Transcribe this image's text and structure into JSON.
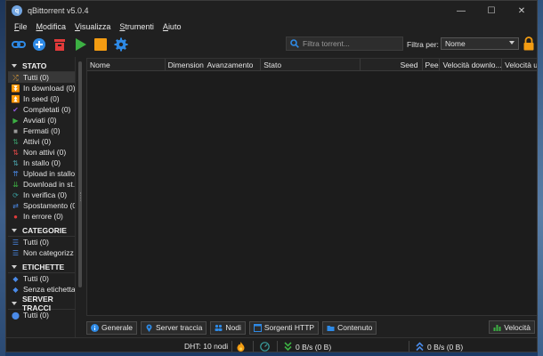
{
  "window": {
    "title": "qBittorrent v5.0.4",
    "icon_letter": "q"
  },
  "window_controls": [
    "—",
    "☐",
    "✕"
  ],
  "menu": [
    {
      "u": "F",
      "rest": "ile"
    },
    {
      "u": "M",
      "rest": "odifica"
    },
    {
      "u": "V",
      "rest": "isualizza"
    },
    {
      "u": "S",
      "rest": "trumenti"
    },
    {
      "u": "A",
      "rest": "iuto"
    }
  ],
  "toolbar": {
    "icons": [
      "add-link-icon",
      "add-torrent-icon",
      "delete-icon",
      "resume-icon",
      "pause-icon",
      "options-icon"
    ],
    "search_placeholder": "Filtra torrent...",
    "filter_label": "Filtra per:",
    "filter_value": "Nome"
  },
  "sidebar": {
    "status": {
      "header": "STATO",
      "items": [
        {
          "label": "Tutti (0)",
          "icon": "shuffle-icon",
          "color": "#e8a33a"
        },
        {
          "label": "In download (0)",
          "icon": "download-icon",
          "color": "#3cb043"
        },
        {
          "label": "In seed (0)",
          "icon": "upload-icon",
          "color": "#4a8ae8"
        },
        {
          "label": "Completati (0)",
          "icon": "check-icon",
          "color": "#8e59d8"
        },
        {
          "label": "Avviati (0)",
          "icon": "play-icon",
          "color": "#3cb043"
        },
        {
          "label": "Fermati (0)",
          "icon": "stop-icon",
          "color": "#9a9a9a"
        },
        {
          "label": "Attivi (0)",
          "icon": "active-icon",
          "color": "#3a9a6a"
        },
        {
          "label": "Non attivi (0)",
          "icon": "inactive-icon",
          "color": "#e04848"
        },
        {
          "label": "In stallo (0)",
          "icon": "stalled-icon",
          "color": "#4aa0a8"
        },
        {
          "label": "Upload in stallo",
          "icon": "stalled-upload-icon",
          "color": "#4a8ae8"
        },
        {
          "label": "Download in st...",
          "icon": "stalled-download-icon",
          "color": "#3cb043"
        },
        {
          "label": "In verifica (0)",
          "icon": "checking-icon",
          "color": "#3aa0a0"
        },
        {
          "label": "Spostamento (0",
          "icon": "moving-icon",
          "color": "#4a8ae8"
        },
        {
          "label": "In errore (0)",
          "icon": "error-icon",
          "color": "#e03a3a"
        }
      ]
    },
    "categories": {
      "header": "CATEGORIE",
      "items": [
        {
          "label": "Tutti (0)",
          "icon": "list-icon",
          "color": "#4a8ae8"
        },
        {
          "label": "Non categorizz",
          "icon": "list-icon",
          "color": "#4a8ae8"
        }
      ]
    },
    "tags": {
      "header": "ETICHETTE",
      "items": [
        {
          "label": "Tutti (0)",
          "icon": "tag-icon",
          "color": "#4a8ae8"
        },
        {
          "label": "Senza etichetta",
          "icon": "tag-icon",
          "color": "#4a8ae8"
        }
      ]
    },
    "trackers": {
      "header": "SERVER TRACCI",
      "items": [
        {
          "label": "Tutti (0)",
          "icon": "pin-icon",
          "color": "#4a8ae8"
        }
      ]
    }
  },
  "table": {
    "columns": [
      "Nome",
      "Dimensione",
      "Avanzamento",
      "Stato",
      "Seed",
      "Peer",
      "Velocità downlo...",
      "Velocità up"
    ]
  },
  "tabs": [
    {
      "label": "Generale",
      "icon": "info-icon"
    },
    {
      "label": "Server traccia",
      "icon": "tracker-icon"
    },
    {
      "label": "Nodi",
      "icon": "peers-icon"
    },
    {
      "label": "Sorgenti HTTP",
      "icon": "http-sources-icon"
    },
    {
      "label": "Contenuto",
      "icon": "folder-icon"
    }
  ],
  "speed_tab": {
    "label": "Velocità",
    "icon": "speed-chart-icon"
  },
  "status": {
    "dht": "DHT: 10 nodi",
    "download": "0 B/s (0 B)",
    "upload": "0 B/s (0 B)"
  },
  "colors": {
    "accent": "#2e8ae6",
    "background": "#202020"
  }
}
